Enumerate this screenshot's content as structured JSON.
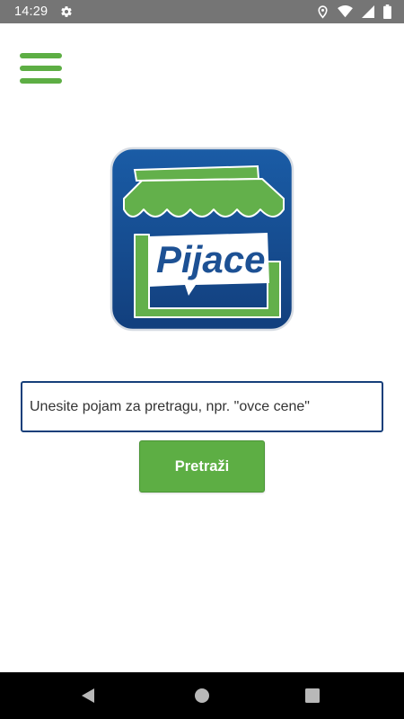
{
  "status_bar": {
    "time": "14:29",
    "icons": [
      "settings-icon",
      "location-icon",
      "wifi-icon",
      "signal-icon",
      "battery-icon"
    ]
  },
  "toolbar": {
    "menu_icon": "hamburger-menu-icon"
  },
  "logo": {
    "text": "Pijace"
  },
  "search": {
    "placeholder": "Unesite pojam za pretragu, npr. \"ovce cene\"",
    "value": "",
    "button_label": "Pretraži"
  },
  "navigation": {
    "icons": [
      "back-icon",
      "home-icon",
      "recents-icon"
    ]
  },
  "colors": {
    "accent_green": "#5dae44",
    "logo_blue": "#1d5194",
    "input_border": "#163f7a",
    "status_bar": "#757575",
    "nav_bar": "#000000"
  }
}
